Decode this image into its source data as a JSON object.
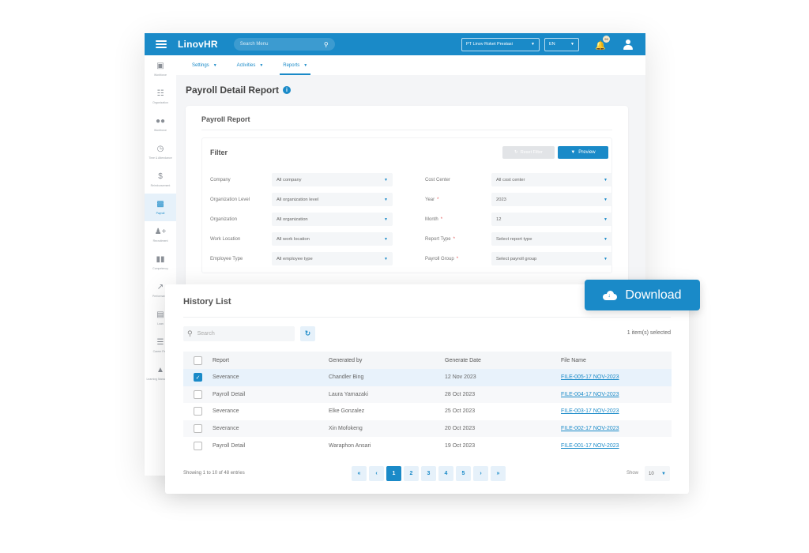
{
  "app": {
    "brand": "LinovHR",
    "search_placeholder": "Search Menu",
    "company_select": "PT Linov Roket Prestasi",
    "language_select": "EN",
    "notification_count": "99"
  },
  "sidebar": {
    "items": [
      {
        "label": "Workforce",
        "icon": "briefcase-icon"
      },
      {
        "label": "Organization",
        "icon": "org-chart-icon"
      },
      {
        "label": "Workforce",
        "icon": "team-icon"
      },
      {
        "label": "Time & Attendance",
        "icon": "clock-icon"
      },
      {
        "label": "Reimbursement",
        "icon": "hand-dollar-icon"
      },
      {
        "label": "Payroll",
        "icon": "money-icon",
        "active": true
      },
      {
        "label": "Recruitment",
        "icon": "user-plus-icon"
      },
      {
        "label": "Competency",
        "icon": "bar-chart-icon"
      },
      {
        "label": "Performance",
        "icon": "line-chart-icon"
      },
      {
        "label": "Loan",
        "icon": "card-icon"
      },
      {
        "label": "Career Path",
        "icon": "signpost-icon"
      },
      {
        "label": "Learning Management",
        "icon": "graduation-icon"
      }
    ]
  },
  "subnav": {
    "tabs": [
      {
        "label": "Settings"
      },
      {
        "label": "Activities"
      },
      {
        "label": "Reports",
        "active": true
      }
    ]
  },
  "page": {
    "title": "Payroll Detail Report",
    "card_title": "Payroll Report",
    "filter": {
      "title": "Filter",
      "reset_label": "Reset Filter",
      "preview_label": "Preview",
      "left": [
        {
          "label": "Company",
          "value": "All company",
          "required": false
        },
        {
          "label": "Organization Level",
          "value": "All organization level",
          "required": false
        },
        {
          "label": "Organization",
          "value": "All organization",
          "required": false
        },
        {
          "label": "Work Location",
          "value": "All work location",
          "required": false
        },
        {
          "label": "Employee Type",
          "value": "All employee type",
          "required": false
        }
      ],
      "right": [
        {
          "label": "Cost Center",
          "value": "All cost center",
          "required": false
        },
        {
          "label": "Year",
          "value": "2023",
          "required": true
        },
        {
          "label": "Month",
          "value": "12",
          "required": true
        },
        {
          "label": "Report Type",
          "value": "Select report type",
          "required": true
        },
        {
          "label": "Payroll Group",
          "value": "Select payroll group",
          "required": true
        }
      ]
    }
  },
  "download": {
    "label": "Download"
  },
  "history": {
    "title": "History List",
    "search_placeholder": "Search",
    "selected_text": "1 item(s) selected",
    "columns": [
      "Report",
      "Generated by",
      "Generate Date",
      "File Name"
    ],
    "rows": [
      {
        "report": "Severance",
        "generated_by": "Chandler Bing",
        "date": "12 Nov 2023",
        "file": "FILE-005-17 NOV-2023",
        "checked": true
      },
      {
        "report": "Payroll Detail",
        "generated_by": "Laura Yamazaki",
        "date": "28 Oct 2023",
        "file": "FILE-004-17 NOV-2023",
        "checked": false
      },
      {
        "report": "Severance",
        "generated_by": "Elke Gonzalez",
        "date": "25 Oct 2023",
        "file": "FILE-003-17 NOV-2023",
        "checked": false
      },
      {
        "report": "Severance",
        "generated_by": "Xin Mofokeng",
        "date": "20 Oct 2023",
        "file": "FILE-002-17 NOV-2023",
        "checked": false
      },
      {
        "report": "Payroll Detail",
        "generated_by": "Waraphon Ansari",
        "date": "19 Oct 2023",
        "file": "FILE-001-17 NOV-2023",
        "checked": false
      }
    ],
    "showing_text": "Showing 1 to 10 of 48 entries",
    "pages": [
      "1",
      "2",
      "3",
      "4",
      "5"
    ],
    "current_page": "1",
    "show_label": "Show",
    "page_size": "10"
  },
  "colors": {
    "accent": "#1a8ac8",
    "selected_row": "#e8f2fb"
  }
}
